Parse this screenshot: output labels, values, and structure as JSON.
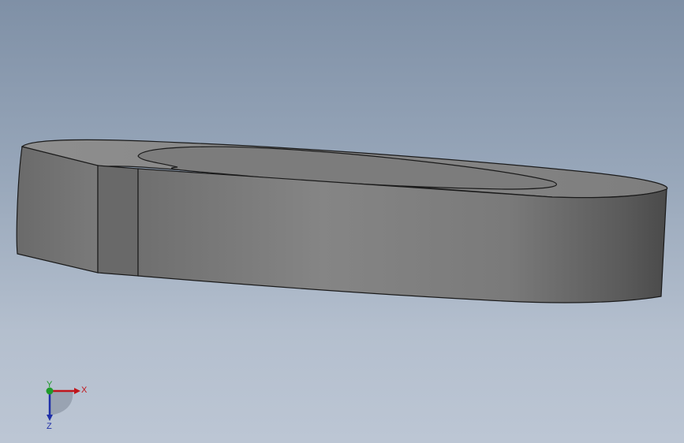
{
  "viewport": {
    "background_top": "#7f90a6",
    "background_bottom": "#bcc6d4"
  },
  "model": {
    "type": "split-ring washer (3D solid)",
    "body_color": "#8a8a8a",
    "edge_color": "#1a1a1a"
  },
  "triad": {
    "x_label": "X",
    "y_label": "Y",
    "z_label": "Z",
    "x_color": "#c0151b",
    "y_color": "#1f9a2a",
    "z_color": "#1f2fa8"
  }
}
